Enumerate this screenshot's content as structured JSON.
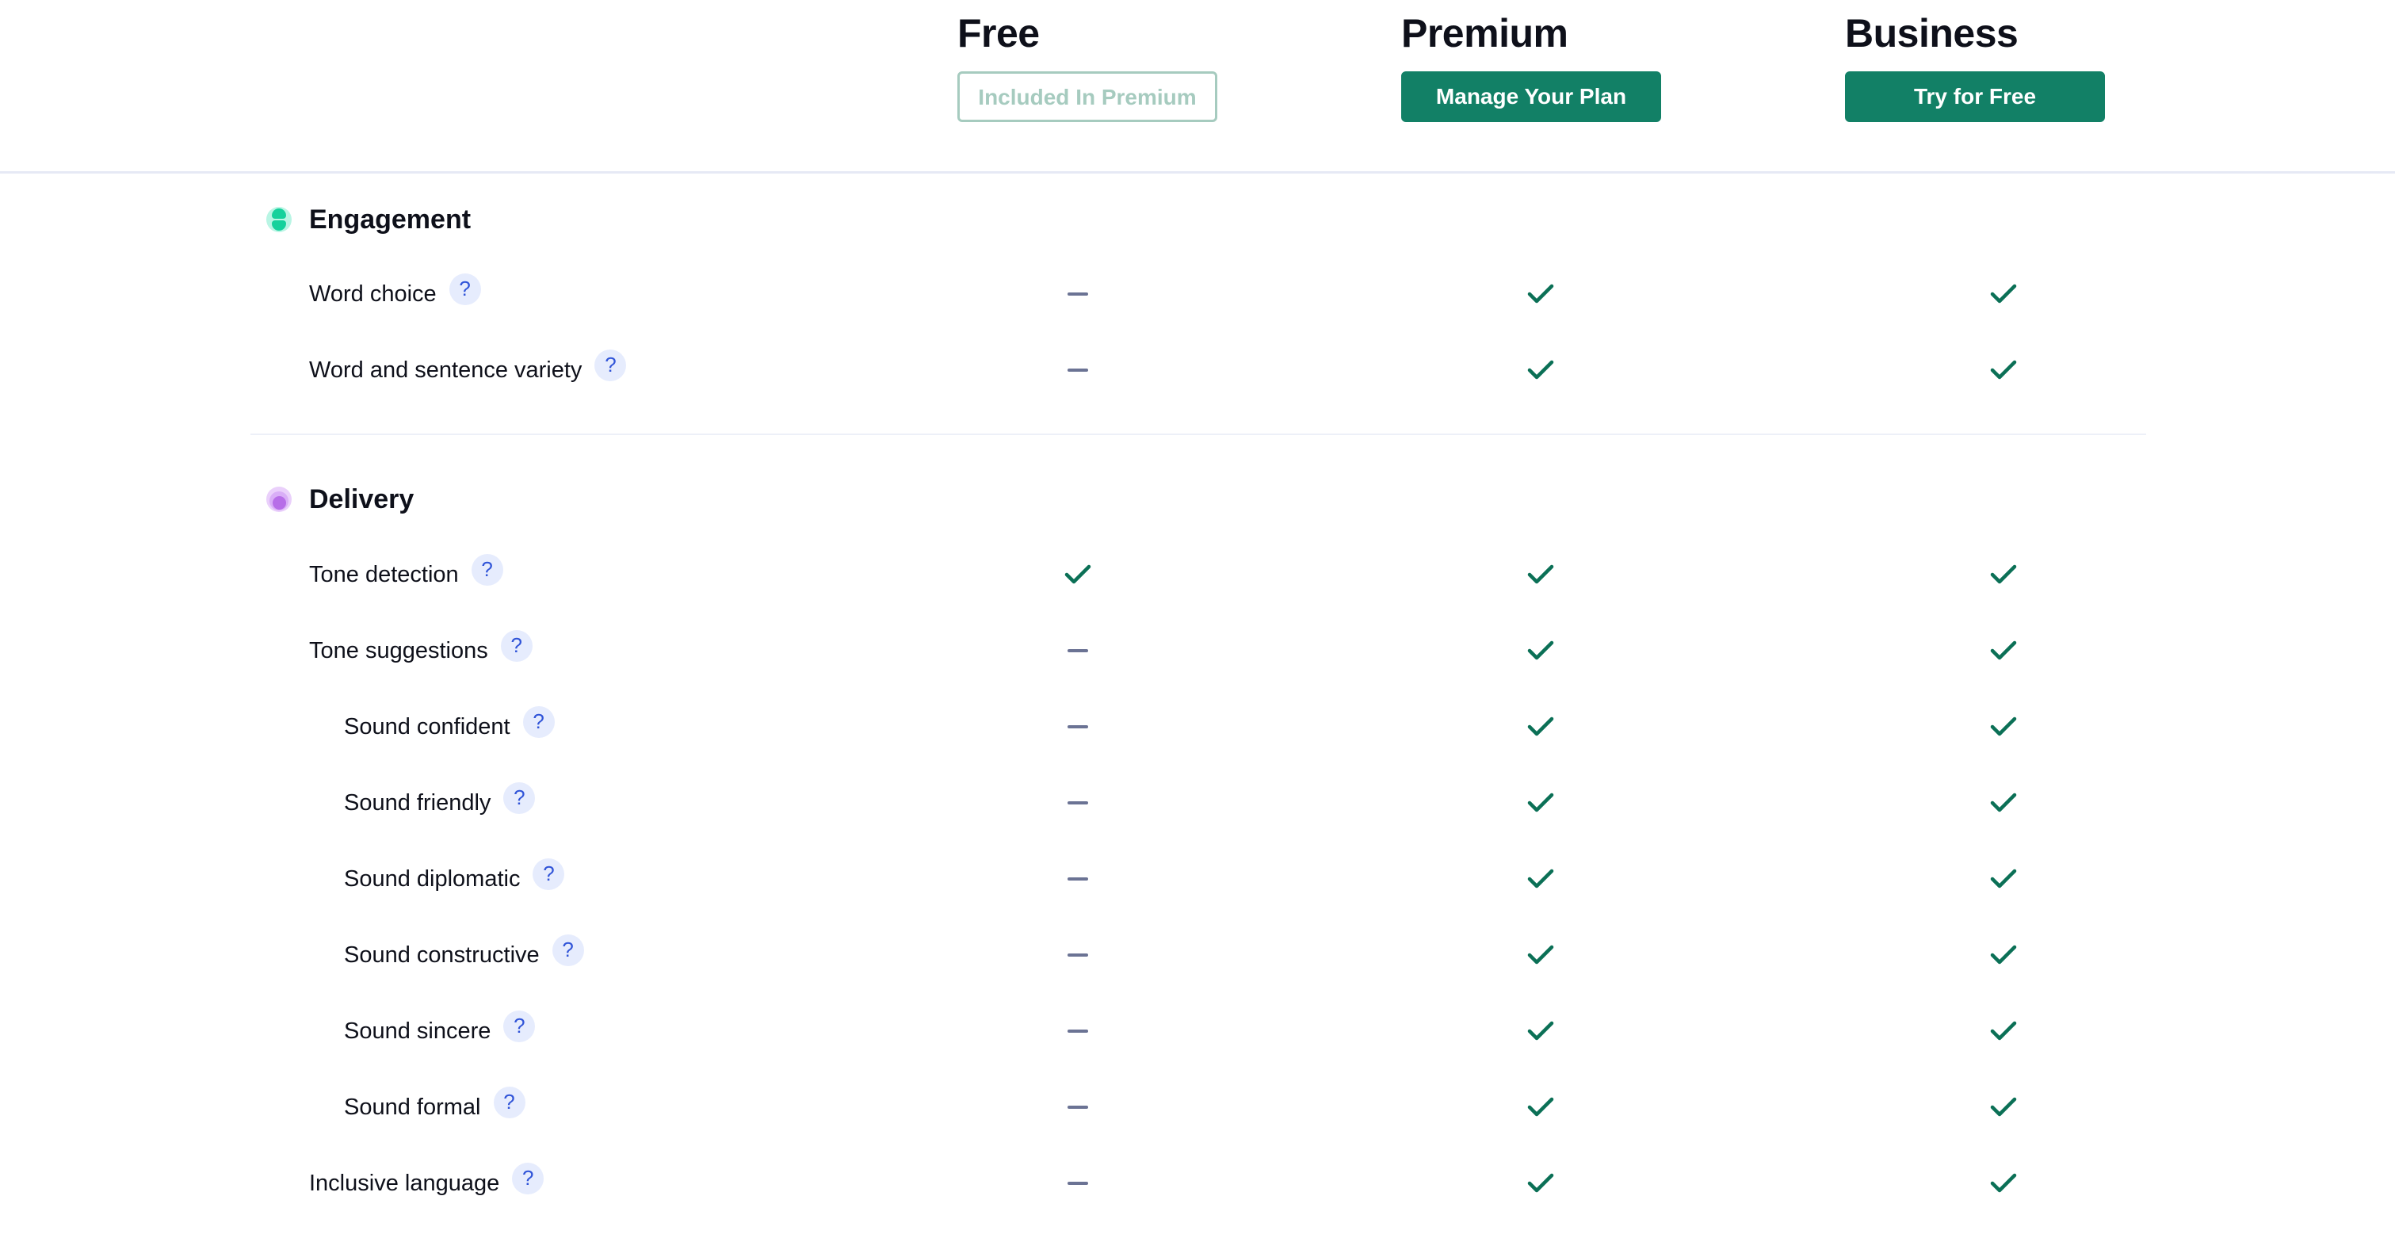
{
  "colors": {
    "accent": "#128066",
    "accent_muted": "#a6cbbf",
    "check": "#0b7056",
    "dash": "#6b7394",
    "help_badge_bg": "#e6ecfd",
    "help_badge_fg": "#3054d8",
    "engagement_icon": "#15d19c",
    "delivery_icon": "#b76ee8"
  },
  "plans": [
    {
      "name": "Free",
      "button_label": "Included In Premium",
      "button_style": "outline",
      "button_enabled": false
    },
    {
      "name": "Premium",
      "button_label": "Manage Your Plan",
      "button_style": "filled",
      "button_enabled": true
    },
    {
      "name": "Business",
      "button_label": "Try for Free",
      "button_style": "filled",
      "button_enabled": true
    }
  ],
  "help_icon_glyph": "?",
  "sections": [
    {
      "title": "Engagement",
      "icon": "engagement-icon",
      "features": [
        {
          "label": "Word choice",
          "level": 1,
          "free": "dash",
          "premium": "check",
          "business": "check"
        },
        {
          "label": "Word and sentence variety",
          "level": 1,
          "free": "dash",
          "premium": "check",
          "business": "check"
        }
      ]
    },
    {
      "title": "Delivery",
      "icon": "delivery-icon",
      "features": [
        {
          "label": "Tone detection",
          "level": 1,
          "free": "check",
          "premium": "check",
          "business": "check"
        },
        {
          "label": "Tone suggestions",
          "level": 1,
          "free": "dash",
          "premium": "check",
          "business": "check"
        },
        {
          "label": "Sound confident",
          "level": 2,
          "free": "dash",
          "premium": "check",
          "business": "check"
        },
        {
          "label": "Sound friendly",
          "level": 2,
          "free": "dash",
          "premium": "check",
          "business": "check"
        },
        {
          "label": "Sound diplomatic",
          "level": 2,
          "free": "dash",
          "premium": "check",
          "business": "check"
        },
        {
          "label": "Sound constructive",
          "level": 2,
          "free": "dash",
          "premium": "check",
          "business": "check"
        },
        {
          "label": "Sound sincere",
          "level": 2,
          "free": "dash",
          "premium": "check",
          "business": "check"
        },
        {
          "label": "Sound formal",
          "level": 2,
          "free": "dash",
          "premium": "check",
          "business": "check"
        },
        {
          "label": "Inclusive language",
          "level": 1,
          "free": "dash",
          "premium": "check",
          "business": "check"
        }
      ]
    }
  ]
}
